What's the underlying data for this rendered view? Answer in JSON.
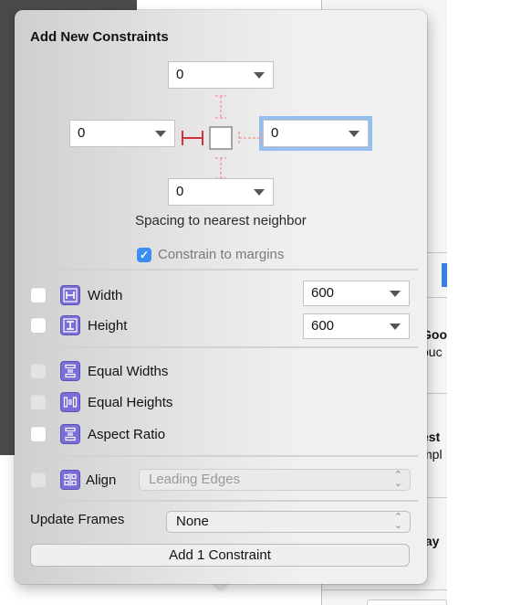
{
  "background": {
    "partial_texts": [
      {
        "text": "Goo",
        "bold": true
      },
      {
        "text": "ouc",
        "bold": false
      },
      {
        "text": "est",
        "bold": true
      },
      {
        "text": "mpl",
        "bold": false
      },
      {
        "text": "lay",
        "bold": true
      }
    ]
  },
  "popover": {
    "title": "Add New Constraints",
    "spacing": {
      "top": {
        "value": "0"
      },
      "left": {
        "value": "0"
      },
      "right": {
        "value": "0"
      },
      "bottom": {
        "value": "0"
      },
      "caption": "Spacing to nearest neighbor",
      "pins": {
        "top": "inactive",
        "left": "active",
        "right": "inactive",
        "bottom": "inactive"
      }
    },
    "constrain_to_margins": {
      "label": "Constrain to margins",
      "checked": true,
      "checkmark": "✓"
    },
    "size_rows": [
      {
        "label": "Width",
        "icon": "width-icon",
        "checked": false,
        "enabled": true,
        "value": "600"
      },
      {
        "label": "Height",
        "icon": "height-icon",
        "checked": false,
        "enabled": true,
        "value": "600"
      }
    ],
    "equal_rows": [
      {
        "label": "Equal Widths",
        "icon": "equal-widths-icon",
        "checked": false,
        "enabled": false
      },
      {
        "label": "Equal Heights",
        "icon": "equal-heights-icon",
        "checked": false,
        "enabled": false
      },
      {
        "label": "Aspect Ratio",
        "icon": "aspect-ratio-icon",
        "checked": false,
        "enabled": true
      }
    ],
    "align": {
      "label": "Align",
      "icon": "align-icon",
      "checked": false,
      "enabled": false,
      "selected": "Leading Edges"
    },
    "update_frames": {
      "label": "Update Frames",
      "selected": "None"
    },
    "add_button": {
      "label": "Add 1 Constraint"
    },
    "colors": {
      "accent": "#3d8ef2",
      "focus_ring": "#95bff0",
      "pin_active": "#d0323c",
      "pin_inactive": "#f0a0a6",
      "icon_purple": "#7a6fd6"
    }
  }
}
